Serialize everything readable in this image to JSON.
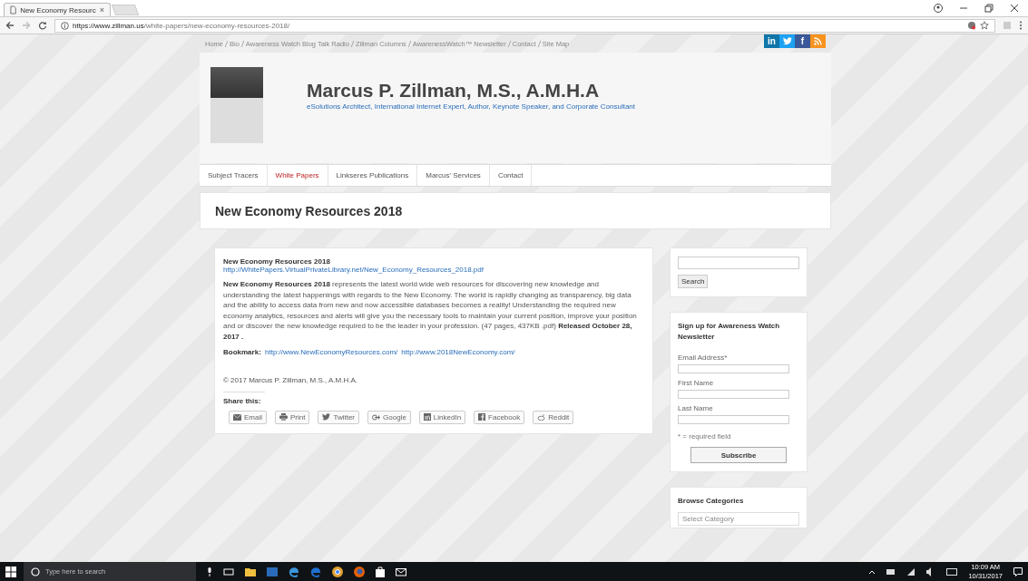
{
  "browser": {
    "tab_title": "New Economy Resourc",
    "tab_close": "×",
    "url_host": "https://www.zillman.us",
    "url_path": "/white-papers/new-economy-resources-2018/"
  },
  "top_links": [
    "Home",
    "Bio",
    "Awareness Watch Blog Talk Radio",
    "Zillman Columns",
    "AwarenessWatch™ Newsletter",
    "Contact",
    "Site Map"
  ],
  "social": [
    {
      "kind": "linkedin",
      "label": "in",
      "color": "#0e76a8"
    },
    {
      "kind": "twitter",
      "color": "#1da1f2"
    },
    {
      "kind": "facebook",
      "label": "f",
      "color": "#3b5998"
    },
    {
      "kind": "rss",
      "color": "#f7931e"
    }
  ],
  "header": {
    "title": "Marcus P. Zillman, M.S., A.M.H.A",
    "tagline": "eSolutions Architect, International Internet Expert, Author, Keynote Speaker, and Corporate Consultant"
  },
  "menu": [
    {
      "label": "Subject Tracers",
      "selected": false
    },
    {
      "label": "White Papers",
      "selected": true
    },
    {
      "label": "Linkseres Publications",
      "selected": false
    },
    {
      "label": "Marcus' Services",
      "selected": false
    },
    {
      "label": "Contact",
      "selected": false
    }
  ],
  "page_title": "New Economy Resources 2018",
  "article": {
    "heading": "New Economy Resources 2018",
    "link": "http://WhitePapers.VirtualPrivateLibrary.net/New_Economy_Resources_2018.pdf",
    "body": "**New Economy Resources 2018** represents the latest world wide web resources for discovering new knowledge and understanding the latest happenings with regards to the New Economy. The world is rapidly changing as transparency, big data and the ability to access data from new and now accessible databases becomes a reality! Understanding the required new economy analytics, resources and alerts will give you the necessary tools to maintain your current position, improve your position and or discover the new knowledge required to be the leader in your profession. (47 pages, 437KB .pdf)  **Released October 28, 2017 .**",
    "bookmark_label": "Bookmark:",
    "bookmarks": [
      "http://www.NewEconomyResources.com/",
      "http://www.2018NewEconomy.com/"
    ],
    "copyright": "© 2017 Marcus P. Zillman, M.S., A.M.H.A.",
    "share_label": "Share this:",
    "share": [
      {
        "kind": "email",
        "label": "Email"
      },
      {
        "kind": "print",
        "label": "Print"
      },
      {
        "kind": "twitter",
        "label": "Twitter"
      },
      {
        "kind": "google",
        "label": "Google"
      },
      {
        "kind": "linkedin",
        "label": "LinkedIn"
      },
      {
        "kind": "facebook",
        "label": "Facebook"
      },
      {
        "kind": "reddit",
        "label": "Reddit"
      }
    ]
  },
  "search_widget": {
    "button": "Search"
  },
  "newsletter": {
    "title": "Sign up for Awareness Watch Newsletter",
    "fields": [
      "Email Address*",
      "First Name",
      "Last Name"
    ],
    "note": "* = required field",
    "button": "Subscribe"
  },
  "categories": {
    "title": "Browse Categories",
    "placeholder": "Select Category"
  },
  "taskbar": {
    "search_placeholder": "Type here to search",
    "time": "10:09 AM",
    "date": "10/31/2017"
  }
}
